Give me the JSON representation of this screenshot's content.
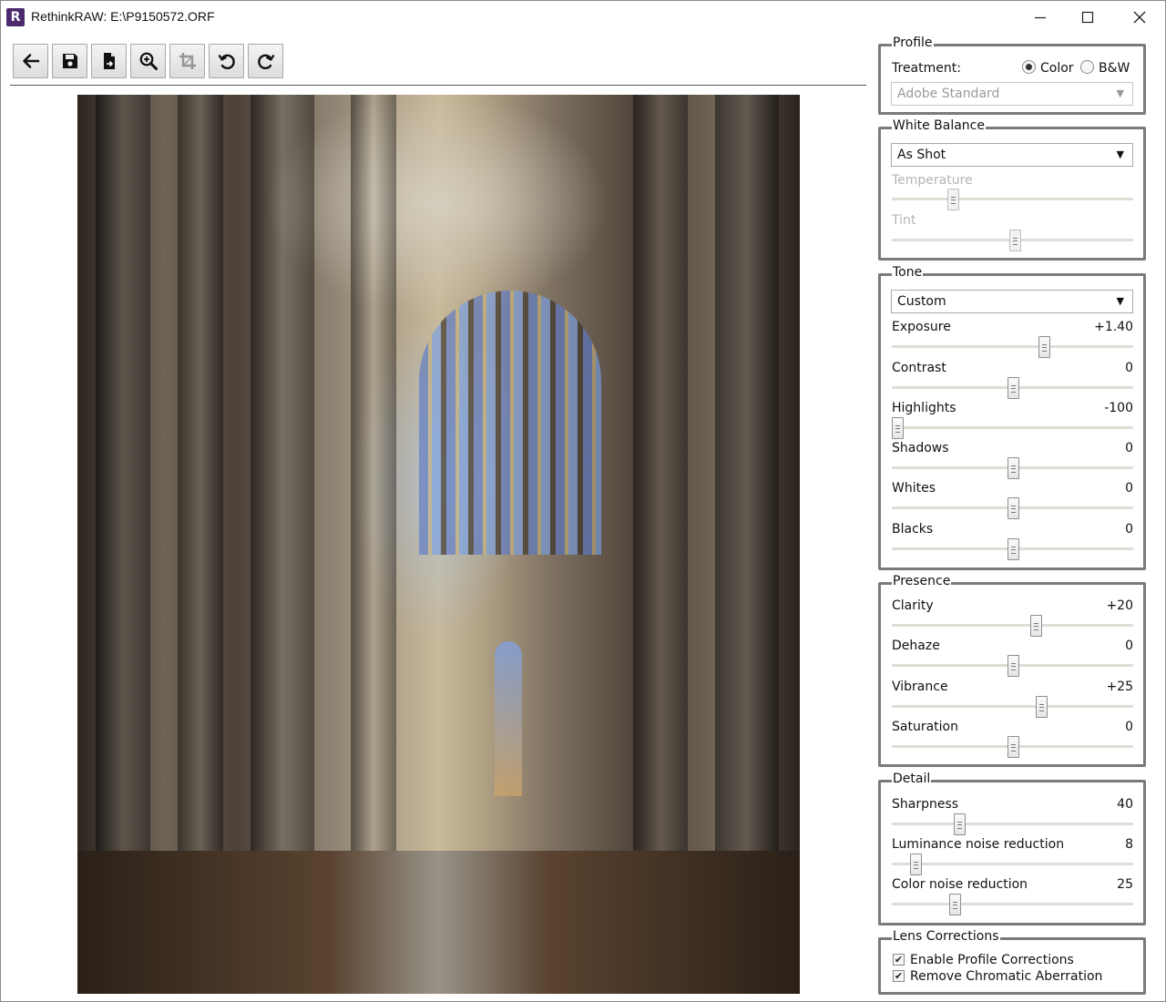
{
  "window": {
    "app_icon_letter": "R",
    "title": "RethinkRAW: E:\\P9150572.ORF",
    "controls": [
      "minimize",
      "maximize",
      "close"
    ]
  },
  "toolbar": {
    "buttons": [
      {
        "name": "back-button",
        "icon": "arrow-left-icon"
      },
      {
        "name": "save-button",
        "icon": "floppy-disk-icon"
      },
      {
        "name": "export-button",
        "icon": "file-export-icon"
      },
      {
        "name": "zoom-button",
        "icon": "zoom-in-icon"
      },
      {
        "name": "crop-button",
        "icon": "crop-icon",
        "disabled": true
      },
      {
        "name": "rotate-left-button",
        "icon": "rotate-ccw-icon"
      },
      {
        "name": "rotate-right-button",
        "icon": "rotate-cw-icon"
      }
    ]
  },
  "photo": {
    "subject": "cathedral-nave-photo"
  },
  "profile": {
    "legend": "Profile",
    "treatment_label": "Treatment:",
    "options": [
      {
        "label": "Color",
        "checked": true
      },
      {
        "label": "B&W",
        "checked": false
      }
    ],
    "profile_select": "Adobe Standard"
  },
  "white_balance": {
    "legend": "White Balance",
    "preset": "As Shot",
    "sliders": [
      {
        "label": "Temperature",
        "level": 0.24,
        "disabled": true
      },
      {
        "label": "Tint",
        "level": 0.51,
        "disabled": true
      }
    ]
  },
  "tone": {
    "legend": "Tone",
    "preset": "Custom",
    "sliders": [
      {
        "label": "Exposure",
        "value": "+1.40",
        "level": 0.635
      },
      {
        "label": "Contrast",
        "value": "0",
        "level": 0.5
      },
      {
        "label": "Highlights",
        "value": "-100",
        "level": 0.0
      },
      {
        "label": "Shadows",
        "value": "0",
        "level": 0.5
      },
      {
        "label": "Whites",
        "value": "0",
        "level": 0.5
      },
      {
        "label": "Blacks",
        "value": "0",
        "level": 0.5
      }
    ]
  },
  "presence": {
    "legend": "Presence",
    "sliders": [
      {
        "label": "Clarity",
        "value": "+20",
        "level": 0.6
      },
      {
        "label": "Dehaze",
        "value": "0",
        "level": 0.5
      },
      {
        "label": "Vibrance",
        "value": "+25",
        "level": 0.625
      },
      {
        "label": "Saturation",
        "value": "0",
        "level": 0.5
      }
    ]
  },
  "detail": {
    "legend": "Detail",
    "sliders": [
      {
        "label": "Sharpness",
        "value": "40",
        "level": 0.27
      },
      {
        "label": "Luminance noise reduction",
        "value": "8",
        "level": 0.08
      },
      {
        "label": "Color noise reduction",
        "value": "25",
        "level": 0.25
      }
    ]
  },
  "lens": {
    "legend": "Lens Corrections",
    "checkboxes": [
      {
        "label": "Enable Profile Corrections",
        "checked": true
      },
      {
        "label": "Remove Chromatic Aberration",
        "checked": true
      }
    ]
  },
  "colors": {
    "group_border": "#7a7a7a",
    "slider_track": "#e0dcd6",
    "app_icon": "#4b2a6e"
  }
}
